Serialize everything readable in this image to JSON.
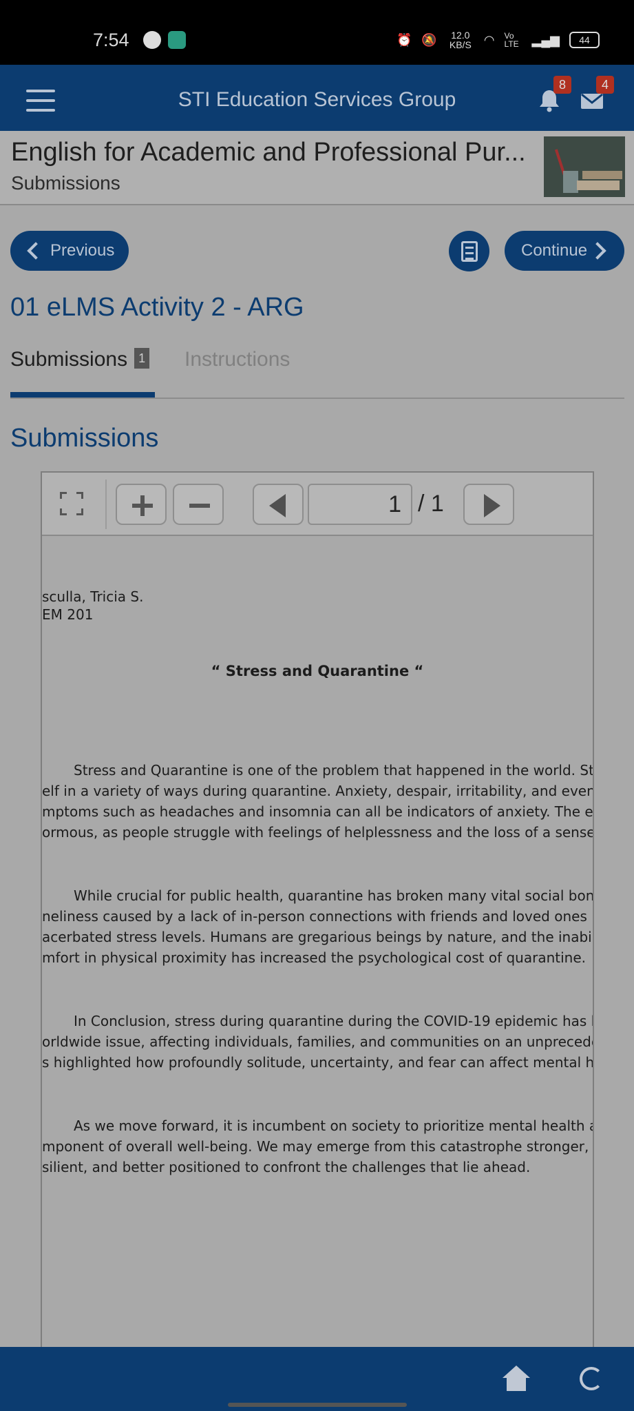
{
  "status_bar": {
    "time": "7:54",
    "network_speed": "12.0 KB/S",
    "network_label": "Vo LTE",
    "battery": "44",
    "icons": [
      "messenger-icon",
      "app-icon",
      "alarm-icon",
      "mute-icon",
      "wifi-icon",
      "signal-icon",
      "battery-icon"
    ]
  },
  "app_bar": {
    "title": "STI Education Services Group",
    "notifications_count": "8",
    "messages_count": "4"
  },
  "course": {
    "title": "English for Academic and Professional Pur...",
    "subtitle": "Submissions"
  },
  "nav": {
    "previous_label": "Previous",
    "continue_label": "Continue"
  },
  "activity": {
    "title": "01 eLMS Activity 2 - ARG"
  },
  "tabs": [
    {
      "label": "Submissions",
      "count": "1",
      "active": true
    },
    {
      "label": "Instructions",
      "active": false
    }
  ],
  "section": {
    "title": "Submissions"
  },
  "viewer": {
    "page_current": "1",
    "page_total": "/ 1"
  },
  "document": {
    "name_line": "sculla, Tricia S.",
    "class_line": "EM 201",
    "heading": "“ Stress and Quarantine “",
    "paragraphs": [
      [
        "Stress and Quarantine is one of the problem that happened in the world. Stress p",
        "elf in a variety of ways during quarantine. Anxiety, despair, irritability, and even physica",
        "mptoms such as headaches and insomnia can all be indicators of anxiety. The emotion",
        "ormous, as people struggle with feelings of helplessness and the loss of a sense of rou"
      ],
      [
        "While crucial for public health, quarantine has broken many vital social bonds.",
        "neliness caused by a lack of in-person connections with friends and loved ones has",
        "acerbated stress levels. Humans are gregarious beings by nature, and the inability to s",
        "mfort in physical proximity has increased the psychological cost of quarantine."
      ],
      [
        "In Conclusion, stress during quarantine during the COVID-19 epidemic has been a",
        "orldwide issue, affecting individuals, families, and communities on an unprecedented s",
        "s highlighted how profoundly solitude, uncertainty, and fear can affect mental health."
      ],
      [
        "As we move forward, it is incumbent on society to prioritize mental health as a cr",
        "mponent of overall well-being. We may emerge from this catastrophe stronger, more",
        "silient, and better positioned to confront the challenges that lie ahead."
      ]
    ]
  },
  "colors": {
    "brand": "#0c3c70",
    "badge": "#b03020",
    "overlay_gray": "#a9a9a9"
  }
}
